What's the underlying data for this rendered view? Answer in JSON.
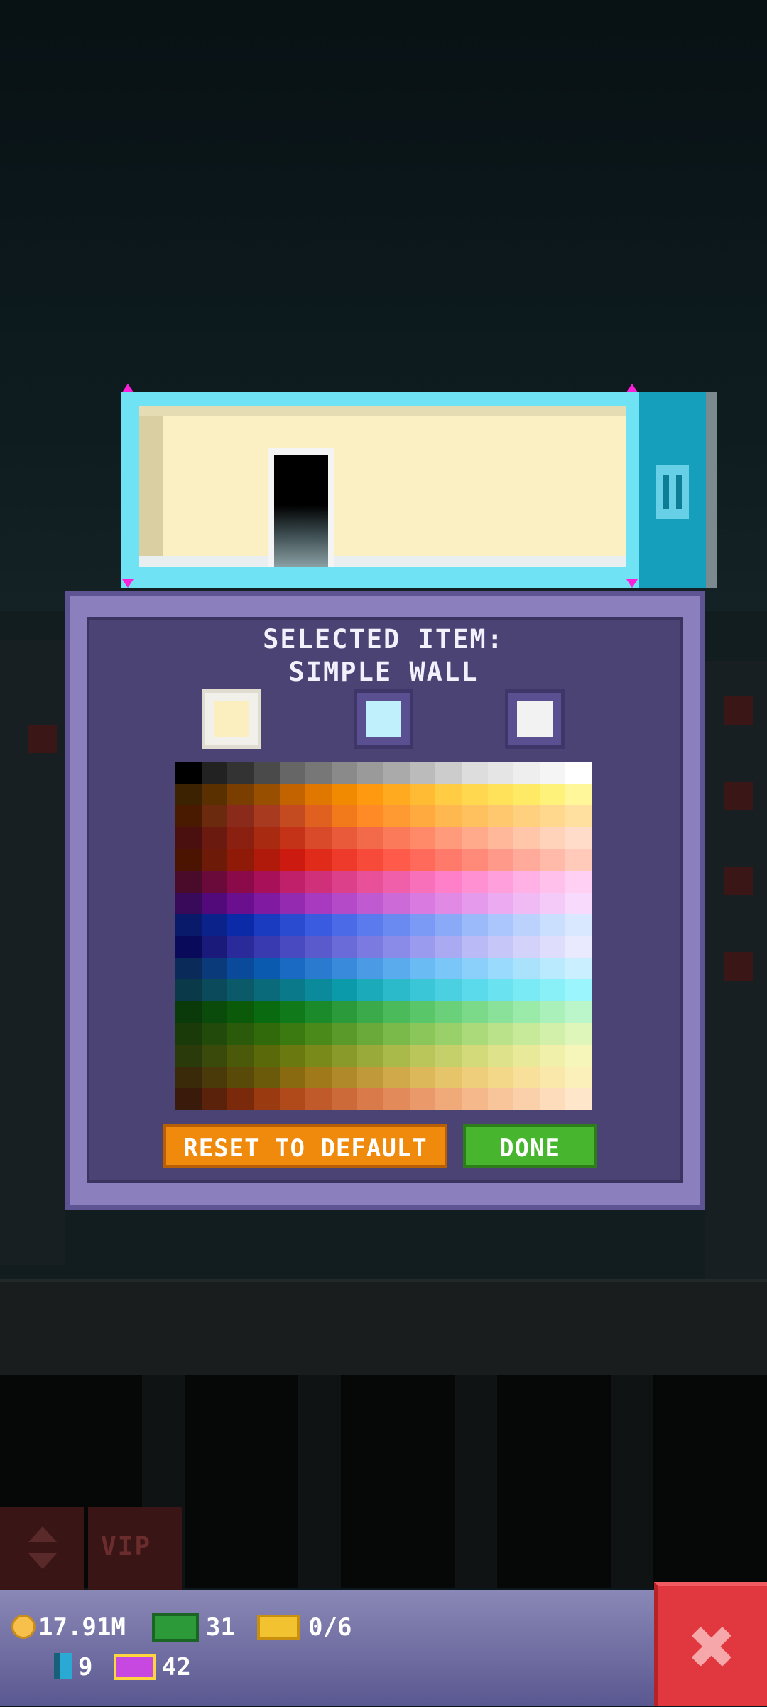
{
  "modal": {
    "title_line1": "SELECTED ITEM:",
    "title_line2": "SIMPLE WALL",
    "swatches": [
      {
        "color": "#fbefc0",
        "selected": true
      },
      {
        "color": "#bff0fb",
        "selected": false
      },
      {
        "color": "#f2f2f2",
        "selected": false
      }
    ],
    "reset_label": "RESET TO DEFAULT",
    "done_label": "DONE"
  },
  "palette_rows": [
    [
      "#000000",
      "#222222",
      "#333333",
      "#4a4a4a",
      "#666666",
      "#777777",
      "#8a8a8a",
      "#9a9a9a",
      "#aaaaaa",
      "#bbbbbb",
      "#cccccc",
      "#dddddd",
      "#e5e5e5",
      "#eeeeee",
      "#f5f5f5",
      "#ffffff"
    ],
    [
      "#3d2200",
      "#5a3000",
      "#7a3f00",
      "#994f00",
      "#c26300",
      "#e07800",
      "#f28a00",
      "#ff9a10",
      "#ffaa1f",
      "#ffbb33",
      "#ffcc44",
      "#ffd84f",
      "#ffe25a",
      "#ffea66",
      "#fff27a",
      "#fff79a"
    ],
    [
      "#4a1a00",
      "#6b2a0d",
      "#8a2a1a",
      "#a83a20",
      "#c44a1f",
      "#e0601f",
      "#f27a1a",
      "#ff8a26",
      "#ff9a33",
      "#ffaa3f",
      "#ffb84f",
      "#ffc05e",
      "#ffc86e",
      "#ffd07e",
      "#ffd88e",
      "#ffe09e"
    ],
    [
      "#4a1010",
      "#6b1a10",
      "#8a2010",
      "#a82a10",
      "#c43318",
      "#d84a2a",
      "#e85a3a",
      "#f26a4a",
      "#fa7a5a",
      "#ff8a6a",
      "#ff9a7a",
      "#ffaa8a",
      "#ffb89a",
      "#ffc6aa",
      "#ffd2ba",
      "#ffdcca"
    ],
    [
      "#4a1400",
      "#6e1a08",
      "#8f1a08",
      "#b01a0a",
      "#cc1a10",
      "#e02a1a",
      "#ee3a2a",
      "#f84a3a",
      "#ff5a4a",
      "#ff6a5a",
      "#ff7a6a",
      "#ff8a7a",
      "#ff9a8a",
      "#ffaa9a",
      "#ffbaaa",
      "#ffcaba"
    ],
    [
      "#4a0a2a",
      "#6a0a3a",
      "#8a0a4a",
      "#a8105a",
      "#c0206a",
      "#d0307a",
      "#dd408a",
      "#e8509a",
      "#f060aa",
      "#f870ba",
      "#ff80c8",
      "#ff90d2",
      "#ffa0dc",
      "#ffb0e4",
      "#ffc0ec",
      "#ffd0f4"
    ],
    [
      "#3a0a5a",
      "#520a7a",
      "#6a108f",
      "#801aa0",
      "#942ab0",
      "#a83ac0",
      "#b44ac8",
      "#c05ad0",
      "#cc6ad8",
      "#d87ae0",
      "#e08ae6",
      "#e69aec",
      "#ecaaf0",
      "#f0baf4",
      "#f4caf8",
      "#f8dafc"
    ],
    [
      "#0a1a6a",
      "#0a228a",
      "#0a2aa8",
      "#1a3ac0",
      "#2a4ad0",
      "#3a5ae0",
      "#4a6ae8",
      "#5a7aee",
      "#6a8af2",
      "#7a9af6",
      "#8aaaf8",
      "#9abafa",
      "#aac6fc",
      "#bad2fc",
      "#cadefe",
      "#dae8ff"
    ],
    [
      "#0a0a5a",
      "#1a1a7a",
      "#2a2a9a",
      "#3a3ab0",
      "#4a4ac0",
      "#5a5acc",
      "#6a6ad8",
      "#7a7ae0",
      "#8a8ae8",
      "#9a9aee",
      "#aaaaf2",
      "#babaf6",
      "#c6c6f8",
      "#d2d2fa",
      "#dedefc",
      "#eaeafe"
    ],
    [
      "#0a2a5a",
      "#0a3a7a",
      "#0a4a9a",
      "#0a5ab0",
      "#1a6ac4",
      "#2a7ad0",
      "#3a8adc",
      "#4a9ae6",
      "#5aaaee",
      "#6abaf4",
      "#7ac6f8",
      "#8ad0fa",
      "#9adafc",
      "#aae2fc",
      "#baeafe",
      "#caf0ff"
    ],
    [
      "#0a3a4a",
      "#0a4a5a",
      "#0a5a6a",
      "#0a6a7a",
      "#0a7a8a",
      "#0a8a9a",
      "#0a9aaa",
      "#1aaaba",
      "#2abaca",
      "#3ac6d6",
      "#4ad0e0",
      "#5adaea",
      "#6ae2f0",
      "#7aeaf4",
      "#8af0f8",
      "#9af6fc"
    ],
    [
      "#0a3a0a",
      "#0a4a0a",
      "#0a5a0a",
      "#0a6a10",
      "#107a1a",
      "#1a8a2a",
      "#2a9a3a",
      "#3aaa4a",
      "#4aba5a",
      "#5ac66a",
      "#6ad07a",
      "#7ada8a",
      "#8ae29a",
      "#9aeaaa",
      "#aaf0ba",
      "#baf6ca"
    ],
    [
      "#1a3a0a",
      "#224a0a",
      "#2a5a0a",
      "#306a0a",
      "#3a7a10",
      "#4a8a1a",
      "#5a9a2a",
      "#6aaa3a",
      "#7aba4a",
      "#8ac65a",
      "#9ad06a",
      "#aada7a",
      "#bae28a",
      "#c6ea9a",
      "#d2f0aa",
      "#def6ba"
    ],
    [
      "#2a3a0a",
      "#3a4a0a",
      "#4a5a0a",
      "#5a6a0a",
      "#6a7a10",
      "#7a8a1a",
      "#8a9a2a",
      "#9aaa3a",
      "#aaba4a",
      "#bac65a",
      "#c6d06a",
      "#d2da7a",
      "#dee28a",
      "#e8ea9a",
      "#f0f0aa",
      "#f6f6ba"
    ],
    [
      "#3a2a0a",
      "#4a3a0a",
      "#5a4a0a",
      "#6a5a0a",
      "#8a6a10",
      "#a07a1a",
      "#b08a2a",
      "#c09a3a",
      "#d0aa4a",
      "#dcb85a",
      "#e6c46a",
      "#eece7a",
      "#f4d88a",
      "#f8e09a",
      "#fae8aa",
      "#fcf0ba"
    ],
    [
      "#3a1a0a",
      "#5a220a",
      "#7a2a0a",
      "#9a3a10",
      "#b04a1a",
      "#c05a2a",
      "#cc6a3a",
      "#d87a4a",
      "#e28a5a",
      "#ea9a6a",
      "#f0aa7a",
      "#f4b88a",
      "#f8c49a",
      "#fad0aa",
      "#fcdcba",
      "#fee6ca"
    ]
  ],
  "bottom_left": {
    "vip_label": "VIP"
  },
  "status": {
    "coins": "17.91M",
    "bux": "31",
    "tickets": "0/6",
    "elevators": "9",
    "vip_tickets": "42"
  }
}
